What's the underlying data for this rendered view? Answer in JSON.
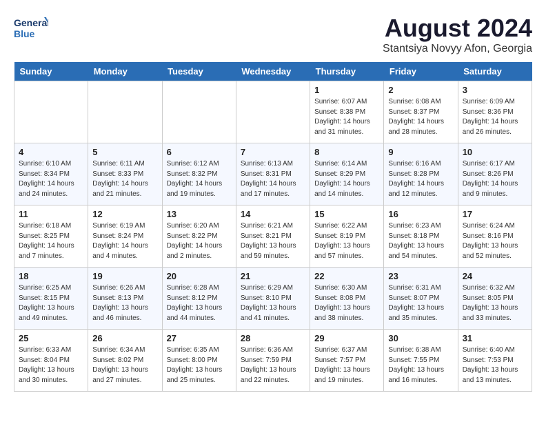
{
  "header": {
    "logo_line1": "General",
    "logo_line2": "Blue",
    "month_title": "August 2024",
    "location": "Stantsiya Novyy Afon, Georgia"
  },
  "days_of_week": [
    "Sunday",
    "Monday",
    "Tuesday",
    "Wednesday",
    "Thursday",
    "Friday",
    "Saturday"
  ],
  "weeks": [
    [
      {
        "day": "",
        "info": ""
      },
      {
        "day": "",
        "info": ""
      },
      {
        "day": "",
        "info": ""
      },
      {
        "day": "",
        "info": ""
      },
      {
        "day": "1",
        "info": "Sunrise: 6:07 AM\nSunset: 8:38 PM\nDaylight: 14 hours\nand 31 minutes."
      },
      {
        "day": "2",
        "info": "Sunrise: 6:08 AM\nSunset: 8:37 PM\nDaylight: 14 hours\nand 28 minutes."
      },
      {
        "day": "3",
        "info": "Sunrise: 6:09 AM\nSunset: 8:36 PM\nDaylight: 14 hours\nand 26 minutes."
      }
    ],
    [
      {
        "day": "4",
        "info": "Sunrise: 6:10 AM\nSunset: 8:34 PM\nDaylight: 14 hours\nand 24 minutes."
      },
      {
        "day": "5",
        "info": "Sunrise: 6:11 AM\nSunset: 8:33 PM\nDaylight: 14 hours\nand 21 minutes."
      },
      {
        "day": "6",
        "info": "Sunrise: 6:12 AM\nSunset: 8:32 PM\nDaylight: 14 hours\nand 19 minutes."
      },
      {
        "day": "7",
        "info": "Sunrise: 6:13 AM\nSunset: 8:31 PM\nDaylight: 14 hours\nand 17 minutes."
      },
      {
        "day": "8",
        "info": "Sunrise: 6:14 AM\nSunset: 8:29 PM\nDaylight: 14 hours\nand 14 minutes."
      },
      {
        "day": "9",
        "info": "Sunrise: 6:16 AM\nSunset: 8:28 PM\nDaylight: 14 hours\nand 12 minutes."
      },
      {
        "day": "10",
        "info": "Sunrise: 6:17 AM\nSunset: 8:26 PM\nDaylight: 14 hours\nand 9 minutes."
      }
    ],
    [
      {
        "day": "11",
        "info": "Sunrise: 6:18 AM\nSunset: 8:25 PM\nDaylight: 14 hours\nand 7 minutes."
      },
      {
        "day": "12",
        "info": "Sunrise: 6:19 AM\nSunset: 8:24 PM\nDaylight: 14 hours\nand 4 minutes."
      },
      {
        "day": "13",
        "info": "Sunrise: 6:20 AM\nSunset: 8:22 PM\nDaylight: 14 hours\nand 2 minutes."
      },
      {
        "day": "14",
        "info": "Sunrise: 6:21 AM\nSunset: 8:21 PM\nDaylight: 13 hours\nand 59 minutes."
      },
      {
        "day": "15",
        "info": "Sunrise: 6:22 AM\nSunset: 8:19 PM\nDaylight: 13 hours\nand 57 minutes."
      },
      {
        "day": "16",
        "info": "Sunrise: 6:23 AM\nSunset: 8:18 PM\nDaylight: 13 hours\nand 54 minutes."
      },
      {
        "day": "17",
        "info": "Sunrise: 6:24 AM\nSunset: 8:16 PM\nDaylight: 13 hours\nand 52 minutes."
      }
    ],
    [
      {
        "day": "18",
        "info": "Sunrise: 6:25 AM\nSunset: 8:15 PM\nDaylight: 13 hours\nand 49 minutes."
      },
      {
        "day": "19",
        "info": "Sunrise: 6:26 AM\nSunset: 8:13 PM\nDaylight: 13 hours\nand 46 minutes."
      },
      {
        "day": "20",
        "info": "Sunrise: 6:28 AM\nSunset: 8:12 PM\nDaylight: 13 hours\nand 44 minutes."
      },
      {
        "day": "21",
        "info": "Sunrise: 6:29 AM\nSunset: 8:10 PM\nDaylight: 13 hours\nand 41 minutes."
      },
      {
        "day": "22",
        "info": "Sunrise: 6:30 AM\nSunset: 8:08 PM\nDaylight: 13 hours\nand 38 minutes."
      },
      {
        "day": "23",
        "info": "Sunrise: 6:31 AM\nSunset: 8:07 PM\nDaylight: 13 hours\nand 35 minutes."
      },
      {
        "day": "24",
        "info": "Sunrise: 6:32 AM\nSunset: 8:05 PM\nDaylight: 13 hours\nand 33 minutes."
      }
    ],
    [
      {
        "day": "25",
        "info": "Sunrise: 6:33 AM\nSunset: 8:04 PM\nDaylight: 13 hours\nand 30 minutes."
      },
      {
        "day": "26",
        "info": "Sunrise: 6:34 AM\nSunset: 8:02 PM\nDaylight: 13 hours\nand 27 minutes."
      },
      {
        "day": "27",
        "info": "Sunrise: 6:35 AM\nSunset: 8:00 PM\nDaylight: 13 hours\nand 25 minutes."
      },
      {
        "day": "28",
        "info": "Sunrise: 6:36 AM\nSunset: 7:59 PM\nDaylight: 13 hours\nand 22 minutes."
      },
      {
        "day": "29",
        "info": "Sunrise: 6:37 AM\nSunset: 7:57 PM\nDaylight: 13 hours\nand 19 minutes."
      },
      {
        "day": "30",
        "info": "Sunrise: 6:38 AM\nSunset: 7:55 PM\nDaylight: 13 hours\nand 16 minutes."
      },
      {
        "day": "31",
        "info": "Sunrise: 6:40 AM\nSunset: 7:53 PM\nDaylight: 13 hours\nand 13 minutes."
      }
    ]
  ]
}
